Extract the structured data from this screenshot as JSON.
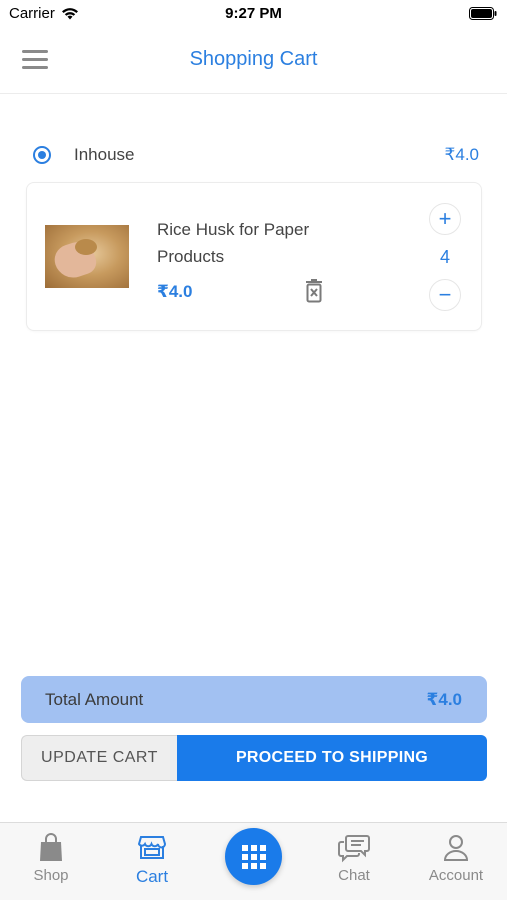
{
  "status_bar": {
    "carrier": "Carrier",
    "time": "9:27 PM"
  },
  "header": {
    "title": "Shopping Cart"
  },
  "seller": {
    "name": "Inhouse",
    "total": "₹4.0"
  },
  "cart_items": [
    {
      "name": "Rice Husk for Paper Products",
      "price": "₹4.0",
      "quantity": "4",
      "plus_symbol": "+",
      "minus_symbol": "−"
    }
  ],
  "totals": {
    "label": "Total Amount",
    "value": "₹4.0"
  },
  "actions": {
    "update_label": "UPDATE CART",
    "proceed_label": "PROCEED TO SHIPPING"
  },
  "bottom_nav": {
    "items": [
      {
        "label": "Shop",
        "icon": "shopping-bag-icon"
      },
      {
        "label": "Cart",
        "icon": "store-icon",
        "active": true
      },
      {
        "label": "",
        "icon": "grid-icon"
      },
      {
        "label": "Chat",
        "icon": "chat-icon"
      },
      {
        "label": "Account",
        "icon": "user-icon"
      }
    ]
  },
  "colors": {
    "accent": "#1a7bea",
    "title_blue": "#2b7fe0",
    "total_bar": "#a2c1f2"
  }
}
